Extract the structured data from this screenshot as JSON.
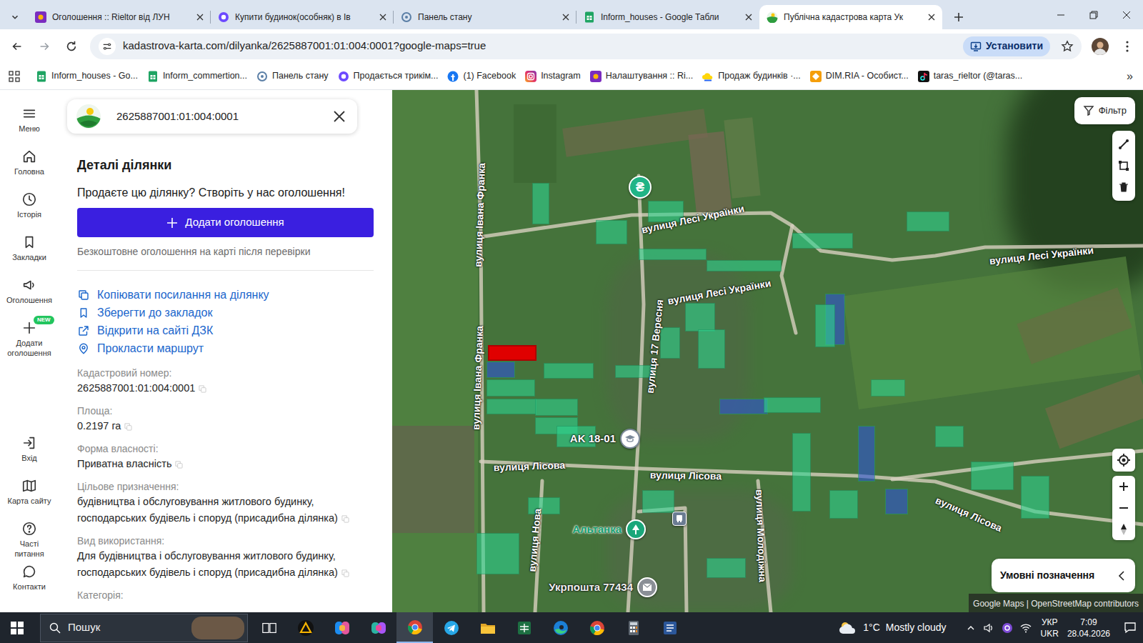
{
  "browser": {
    "tabs": [
      {
        "label": "Оголошення :: Rieltor від ЛУН",
        "kind": "rieltor",
        "selected": false
      },
      {
        "label": "Купити будинок(особняк) в Ів",
        "kind": "lun",
        "selected": false
      },
      {
        "label": "Панель стану",
        "kind": "panel",
        "selected": false
      },
      {
        "label": "Inform_houses - Google Табли",
        "kind": "sheets",
        "selected": false
      },
      {
        "label": "Публічна кадастрова карта Ук",
        "kind": "kadastr",
        "selected": true
      }
    ],
    "url": "kadastrova-karta.com/dilyanka/2625887001:01:004:0001?google-maps=true",
    "install_button": "Установити",
    "bookmarks": [
      {
        "label": "Inform_houses - Go...",
        "kind": "sheets"
      },
      {
        "label": "Inform_commertion...",
        "kind": "sheets"
      },
      {
        "label": "Панель стану",
        "kind": "panel"
      },
      {
        "label": "Продається трикім...",
        "kind": "lun"
      },
      {
        "label": "(1) Facebook",
        "kind": "facebook"
      },
      {
        "label": "Instagram",
        "kind": "instagram"
      },
      {
        "label": "Налаштування :: Ri...",
        "kind": "rieltor"
      },
      {
        "label": "Продаж будинків ·...",
        "kind": "cloud"
      },
      {
        "label": "DIM.RIA - Особист...",
        "kind": "dimria"
      },
      {
        "label": "taras_rieltor (@taras...",
        "kind": "tiktok"
      }
    ],
    "bookmarks_more": "»"
  },
  "nav": {
    "top": [
      {
        "label": "Меню"
      },
      {
        "label": "Головна"
      },
      {
        "label": "Історія"
      },
      {
        "label": "Закладки"
      },
      {
        "label": "Оголошення"
      },
      {
        "label": "Додати оголошення",
        "badge": "NEW"
      }
    ],
    "bottom": [
      {
        "label": "Вхід"
      },
      {
        "label": "Карта сайту"
      },
      {
        "label": "Часті питання"
      },
      {
        "label": "Контакти"
      }
    ]
  },
  "panel": {
    "search_value": "2625887001:01:004:0001",
    "title": "Деталі ділянки",
    "promo": "Продаєте цю ділянку? Створіть у нас оголошення!",
    "add_button": "Додати оголошення",
    "note": "Безкоштовне оголошення на карті після перевірки",
    "links": [
      {
        "label": "Копіювати посилання на ділянку"
      },
      {
        "label": "Зберегти до закладок"
      },
      {
        "label": "Відкрити на сайті ДЗК"
      },
      {
        "label": "Прокласти маршрут"
      }
    ],
    "fields": [
      {
        "label": "Кадастровий номер:",
        "value": "2625887001:01:004:0001"
      },
      {
        "label": "Площа:",
        "value": "0.2197 га"
      },
      {
        "label": "Форма власності:",
        "value": "Приватна власність"
      },
      {
        "label": "Цільове призначення:",
        "value": "будівництва і обслуговування житлового будинку, господарських будівель і споруд (присадибна ділянка)"
      },
      {
        "label": "Вид використання:",
        "value": "Для будівництва і обслуговування житлового будинку, господарських будівель і споруд (присадибна ділянка)"
      }
    ],
    "more_label": "Категорія:"
  },
  "map": {
    "filter": "Фільтр",
    "legend": "Умовні позначення",
    "attribution": "Google Maps | OpenStreetMap contributors",
    "streets": [
      "вулиця Івана Франка",
      "вулиця Івана Франка",
      "вулиця Лесі Українки",
      "вулиця Лесі Українки",
      "вулиця Лесі Українки",
      "вулиця 17 Вересня",
      "вулиця Лісова",
      "вулиця Лісова",
      "вулиця Лісова",
      "вулиця Нова",
      "вулиця Молодіжна"
    ],
    "places": [
      {
        "kind": "bank",
        "icon": "₴"
      },
      {
        "kind": "school",
        "label": "AK 18-01"
      },
      {
        "kind": "park",
        "label": "Альтанка"
      },
      {
        "kind": "bus"
      },
      {
        "kind": "post",
        "label": "Укрпошта 77434"
      }
    ],
    "parcels": [
      {
        "color": "#e00000",
        "selected": true
      },
      {
        "color": "#2f55d4",
        "selected": false
      },
      {
        "color": "#2f55d4",
        "selected": false
      },
      {
        "color": "#2f55d4",
        "selected": false
      },
      {
        "color": "#2f55d4",
        "selected": false
      },
      {
        "color": "#2f55d4",
        "selected": false
      },
      {
        "color": "#2fd38f",
        "selected": false
      },
      {
        "color": "#2fd38f",
        "selected": false
      },
      {
        "color": "#2fd38f",
        "selected": false
      },
      {
        "color": "#2fd38f",
        "selected": false
      },
      {
        "color": "#2fd38f",
        "selected": false
      },
      {
        "color": "#2fd38f",
        "selected": false
      },
      {
        "color": "#2fd38f",
        "selected": false
      },
      {
        "color": "#2fd38f",
        "selected": false
      },
      {
        "color": "#2fd38f",
        "selected": false
      },
      {
        "color": "#2fd38f",
        "selected": false
      },
      {
        "color": "#2fd38f",
        "selected": false
      },
      {
        "color": "#2fd38f",
        "selected": false
      },
      {
        "color": "#2fd38f",
        "selected": false
      },
      {
        "color": "#2fd38f",
        "selected": false
      },
      {
        "color": "#2fd38f",
        "selected": false
      },
      {
        "color": "#2fd38f",
        "selected": false
      },
      {
        "color": "#2fd38f",
        "selected": false
      },
      {
        "color": "#2fd38f",
        "selected": false
      },
      {
        "color": "#2fd38f",
        "selected": false
      },
      {
        "color": "#2fd38f",
        "selected": false
      },
      {
        "color": "#2fd38f",
        "selected": false
      },
      {
        "color": "#2fd38f",
        "selected": false
      },
      {
        "color": "#2fd38f",
        "selected": false
      },
      {
        "color": "#2fd38f",
        "selected": false
      },
      {
        "color": "#2fd38f",
        "selected": false
      },
      {
        "color": "#2fd38f",
        "selected": false
      },
      {
        "color": "#2fd38f",
        "selected": false
      },
      {
        "color": "#2fd38f",
        "selected": false
      },
      {
        "color": "#2fd38f",
        "selected": false
      }
    ]
  },
  "taskbar": {
    "search": "Пошук",
    "apps": [
      {
        "kind": "task-view",
        "active": false
      },
      {
        "kind": "amber",
        "active": false
      },
      {
        "kind": "copilot-pro",
        "active": false
      },
      {
        "kind": "copilot",
        "active": false
      },
      {
        "kind": "chrome",
        "active": true
      },
      {
        "kind": "telegram",
        "active": false
      },
      {
        "kind": "explorer",
        "active": false
      },
      {
        "kind": "excel",
        "active": false
      },
      {
        "kind": "edge",
        "active": false
      },
      {
        "kind": "chrome",
        "active": false
      },
      {
        "kind": "calculator",
        "active": false
      },
      {
        "kind": "word",
        "active": false
      }
    ],
    "temperature": "1°C",
    "condition": "Mostly cloudy",
    "lang_top": "УКР",
    "lang_bottom": "UKR",
    "time": "7:09",
    "date": "28.04.2026"
  }
}
